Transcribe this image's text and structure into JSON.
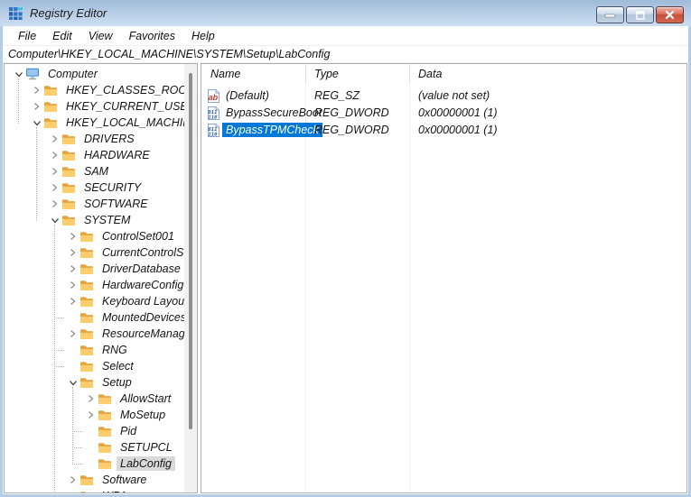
{
  "window": {
    "title": "Registry Editor",
    "controls": {
      "minimize": "minimize",
      "maximize": "maximize",
      "close": "close"
    }
  },
  "menu": {
    "items": [
      "File",
      "Edit",
      "View",
      "Favorites",
      "Help"
    ]
  },
  "address": {
    "value": "Computer\\HKEY_LOCAL_MACHINE\\SYSTEM\\Setup\\LabConfig"
  },
  "tree": {
    "items": [
      {
        "label": "Computer",
        "level": 0,
        "state": "expanded",
        "icon": "computer",
        "selected": false
      },
      {
        "label": "HKEY_CLASSES_ROOT",
        "level": 1,
        "state": "collapsed",
        "icon": "folder",
        "selected": false
      },
      {
        "label": "HKEY_CURRENT_USER",
        "level": 1,
        "state": "collapsed",
        "icon": "folder",
        "selected": false
      },
      {
        "label": "HKEY_LOCAL_MACHINE",
        "level": 1,
        "state": "expanded",
        "icon": "folder",
        "selected": false
      },
      {
        "label": "DRIVERS",
        "level": 2,
        "state": "collapsed",
        "icon": "folder",
        "selected": false
      },
      {
        "label": "HARDWARE",
        "level": 2,
        "state": "collapsed",
        "icon": "folder",
        "selected": false
      },
      {
        "label": "SAM",
        "level": 2,
        "state": "collapsed",
        "icon": "folder",
        "selected": false
      },
      {
        "label": "SECURITY",
        "level": 2,
        "state": "collapsed",
        "icon": "folder",
        "selected": false
      },
      {
        "label": "SOFTWARE",
        "level": 2,
        "state": "collapsed",
        "icon": "folder",
        "selected": false
      },
      {
        "label": "SYSTEM",
        "level": 2,
        "state": "expanded",
        "icon": "folder",
        "selected": false
      },
      {
        "label": "ControlSet001",
        "level": 3,
        "state": "collapsed",
        "icon": "folder",
        "selected": false
      },
      {
        "label": "CurrentControlSet",
        "level": 3,
        "state": "collapsed",
        "icon": "folder",
        "selected": false
      },
      {
        "label": "DriverDatabase",
        "level": 3,
        "state": "collapsed",
        "icon": "folder",
        "selected": false
      },
      {
        "label": "HardwareConfig",
        "level": 3,
        "state": "collapsed",
        "icon": "folder",
        "selected": false
      },
      {
        "label": "Keyboard Layout",
        "level": 3,
        "state": "collapsed",
        "icon": "folder",
        "selected": false
      },
      {
        "label": "MountedDevices",
        "level": 3,
        "state": "leaf",
        "icon": "folder",
        "selected": false
      },
      {
        "label": "ResourceManager",
        "level": 3,
        "state": "collapsed",
        "icon": "folder",
        "selected": false
      },
      {
        "label": "RNG",
        "level": 3,
        "state": "leaf",
        "icon": "folder",
        "selected": false
      },
      {
        "label": "Select",
        "level": 3,
        "state": "leaf",
        "icon": "folder",
        "selected": false
      },
      {
        "label": "Setup",
        "level": 3,
        "state": "expanded",
        "icon": "folder",
        "selected": false
      },
      {
        "label": "AllowStart",
        "level": 4,
        "state": "collapsed",
        "icon": "folder",
        "selected": false
      },
      {
        "label": "MoSetup",
        "level": 4,
        "state": "collapsed",
        "icon": "folder",
        "selected": false
      },
      {
        "label": "Pid",
        "level": 4,
        "state": "leaf",
        "icon": "folder",
        "selected": false
      },
      {
        "label": "SETUPCL",
        "level": 4,
        "state": "leaf",
        "icon": "folder",
        "selected": false
      },
      {
        "label": "LabConfig",
        "level": 4,
        "state": "leaf",
        "icon": "folder",
        "selected": true
      },
      {
        "label": "Software",
        "level": 3,
        "state": "collapsed",
        "icon": "folder",
        "selected": false
      },
      {
        "label": "WPA",
        "level": 3,
        "state": "leaf",
        "icon": "folder",
        "selected": false
      }
    ]
  },
  "list": {
    "columns": [
      "Name",
      "Type",
      "Data"
    ],
    "rows": [
      {
        "icon": "reg-sz",
        "name": "(Default)",
        "type": "REG_SZ",
        "data": "(value not set)",
        "selected": false
      },
      {
        "icon": "reg-dword",
        "name": "BypassSecureBoot",
        "type": "REG_DWORD",
        "data": "0x00000001 (1)",
        "selected": false
      },
      {
        "icon": "reg-dword",
        "name": "BypassTPMCheck",
        "type": "REG_DWORD",
        "data": "0x00000001 (1)",
        "selected": true
      }
    ]
  },
  "colors": {
    "accent_selection": "#0078d7",
    "inactive_selection": "#d9d9d9",
    "titlebar_top": "#9fbbd8",
    "titlebar_bottom": "#ccddf0",
    "frame": "#b3cde9",
    "folder": "#fdb931",
    "scrollbar_thumb": "#8d8d8d"
  }
}
